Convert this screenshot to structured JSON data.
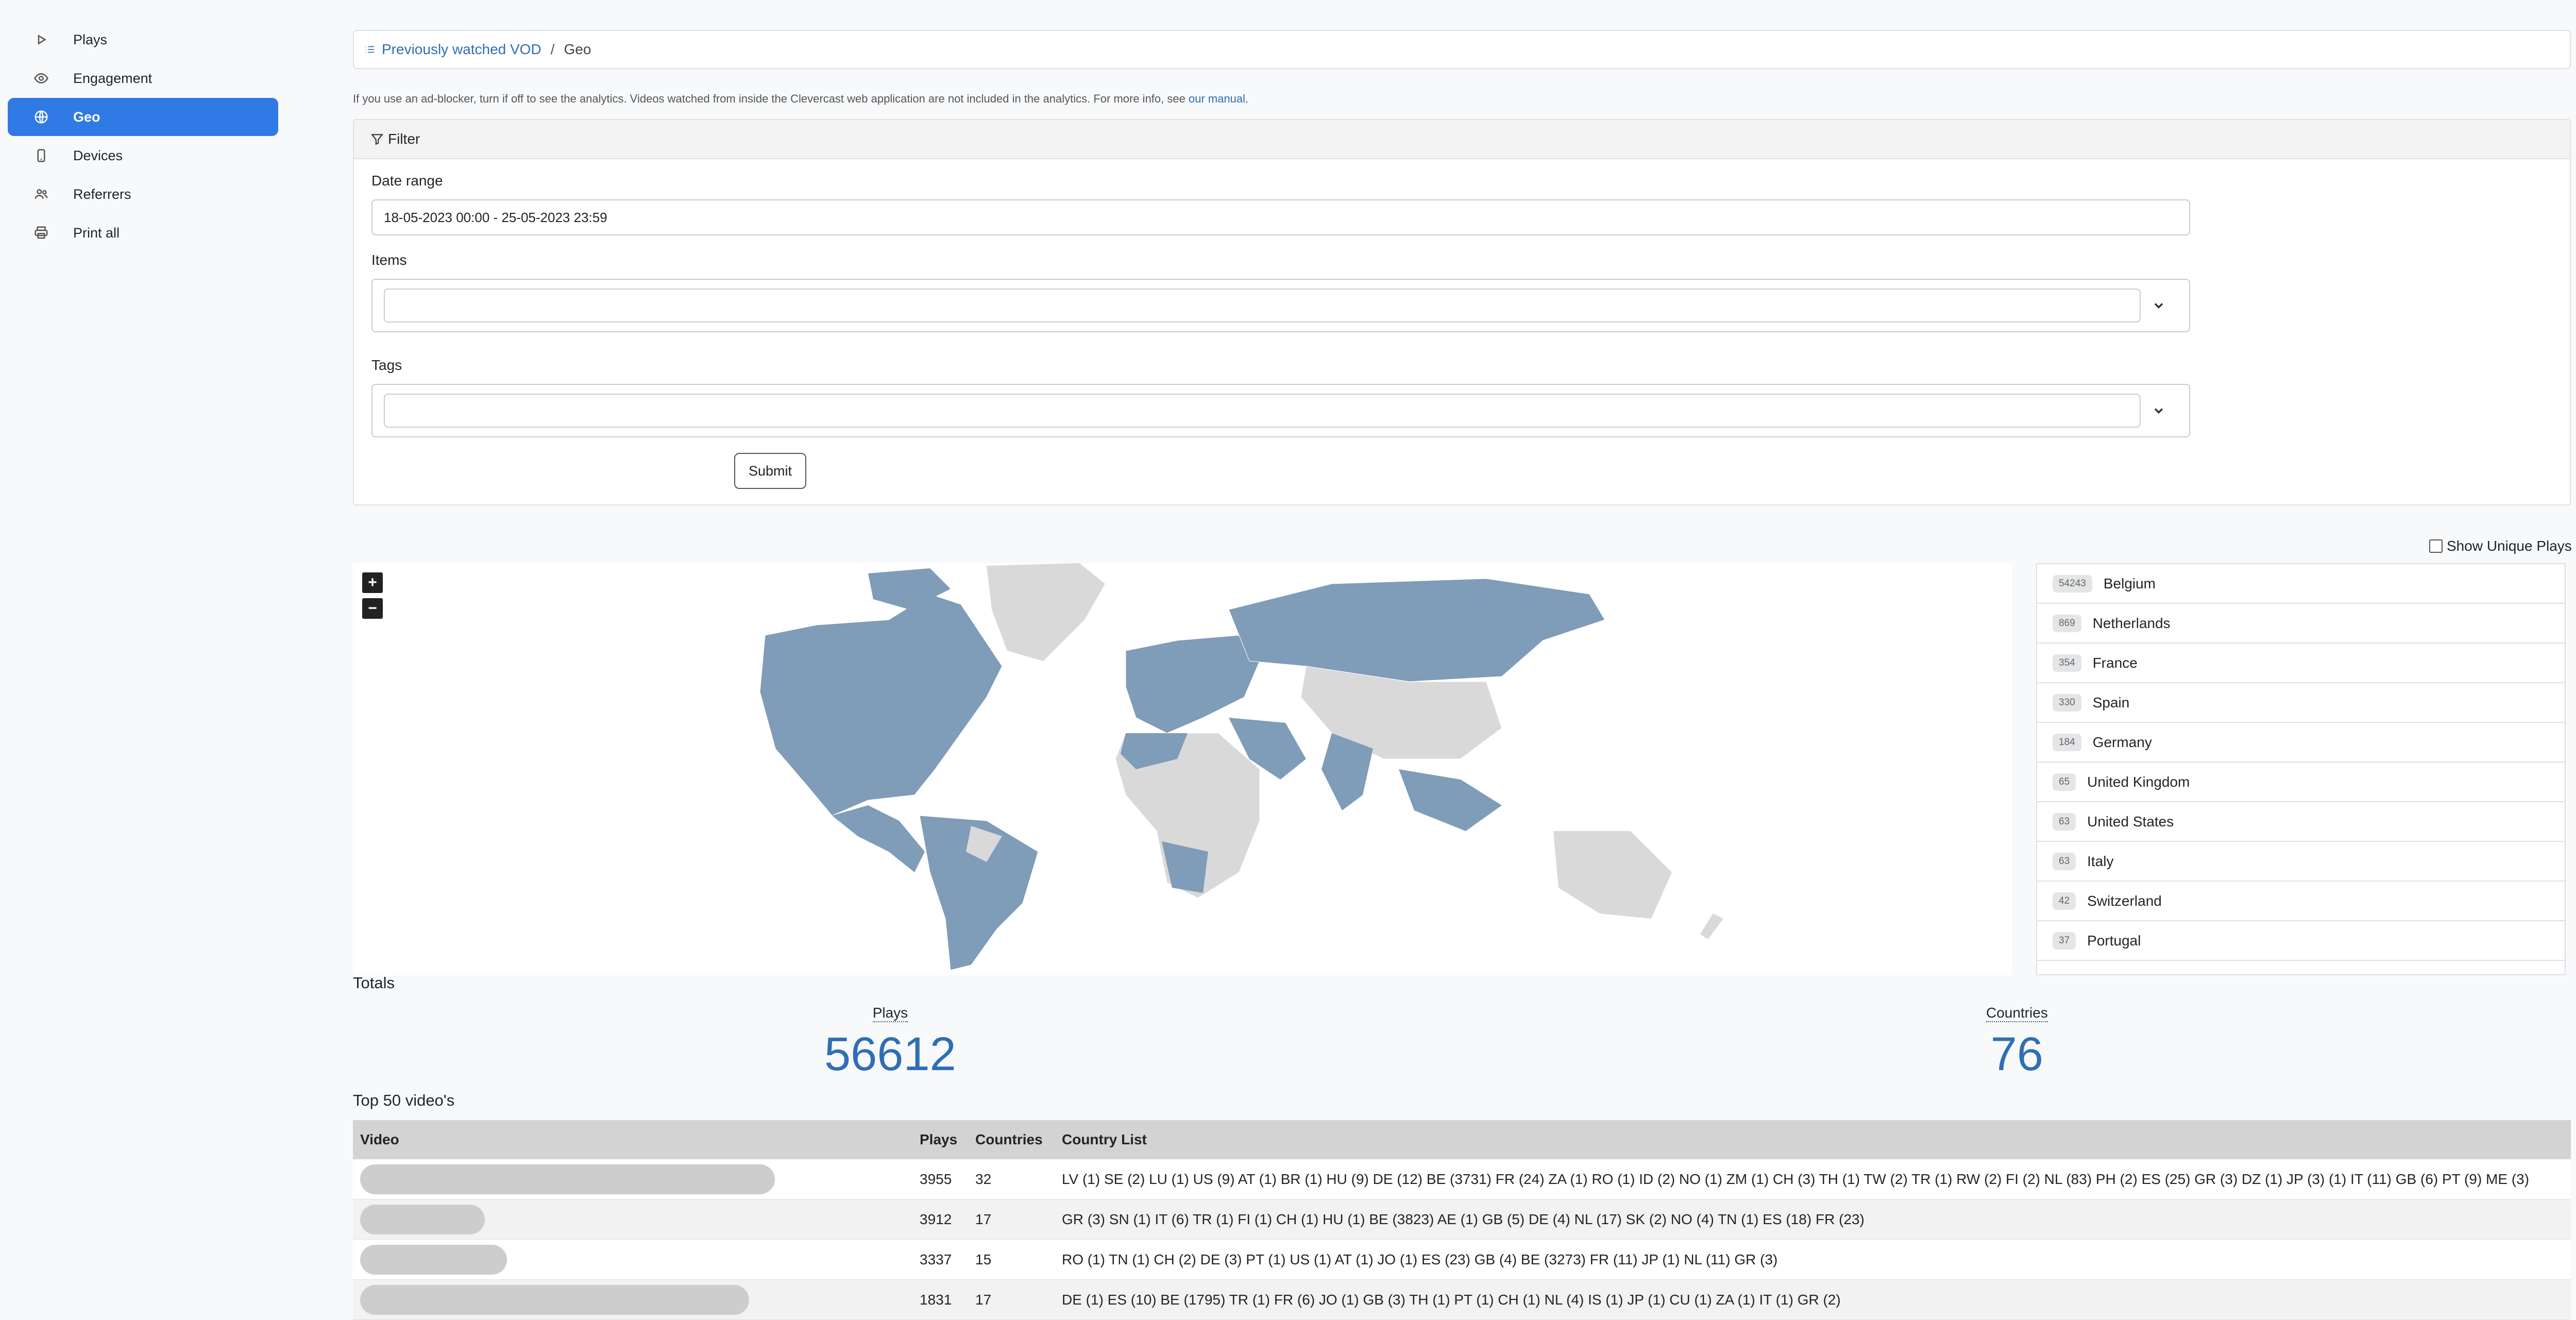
{
  "sidebar": {
    "items": [
      {
        "label": "Plays",
        "icon": "play-icon"
      },
      {
        "label": "Engagement",
        "icon": "eye-icon"
      },
      {
        "label": "Geo",
        "icon": "globe-icon",
        "active": true
      },
      {
        "label": "Devices",
        "icon": "phone-icon"
      },
      {
        "label": "Referrers",
        "icon": "users-icon"
      },
      {
        "label": "Print all",
        "icon": "printer-icon"
      }
    ]
  },
  "breadcrumb": {
    "parent": "Previously watched VOD",
    "separator": "/",
    "current": "Geo"
  },
  "info": {
    "text": "If you use an ad-blocker, turn if off to see the analytics. Videos watched from inside the Clevercast web application are not included in the analytics. For more info, see ",
    "link": "our manual",
    "suffix": "."
  },
  "filter": {
    "title": "Filter",
    "date_label": "Date range",
    "date_value": "18-05-2023 00:00 - 25-05-2023 23:59",
    "items_label": "Items",
    "tags_label": "Tags",
    "submit": "Submit"
  },
  "show_unique": "Show Unique Plays",
  "zoom": {
    "in": "+",
    "out": "−"
  },
  "countries": [
    {
      "count": "54243",
      "name": "Belgium"
    },
    {
      "count": "869",
      "name": "Netherlands"
    },
    {
      "count": "354",
      "name": "France"
    },
    {
      "count": "330",
      "name": "Spain"
    },
    {
      "count": "184",
      "name": "Germany"
    },
    {
      "count": "65",
      "name": "United Kingdom"
    },
    {
      "count": "63",
      "name": "United States"
    },
    {
      "count": "63",
      "name": "Italy"
    },
    {
      "count": "42",
      "name": "Switzerland"
    },
    {
      "count": "37",
      "name": "Portugal"
    }
  ],
  "totals": {
    "title": "Totals",
    "plays_label": "Plays",
    "plays_value": "56612",
    "countries_label": "Countries",
    "countries_value": "76"
  },
  "top50": {
    "title": "Top 50 video's",
    "headers": [
      "Video",
      "Plays",
      "Countries",
      "Country List"
    ],
    "rows": [
      {
        "plays": "3955",
        "countries": "32",
        "list": "LV (1) SE (2) LU (1) US (9) AT (1) BR (1) HU (9) DE (12) BE (3731) FR (24) ZA (1) RO (1) ID (2) NO (1) ZM (1) CH (3) TH (1) TW (2) TR (1) RW (2) FI (2) NL (83) PH (2) ES (25) GR (3) DZ (1) JP (3) (1) IT (11) GB (6) PT (9) ME (3)"
      },
      {
        "plays": "3912",
        "countries": "17",
        "list": "GR (3) SN (1) IT (6) TR (1) FI (1) CH (1) HU (1) BE (3823) AE (1) GB (5) DE (4) NL (17) SK (2) NO (4) TN (1) ES (18) FR (23)"
      },
      {
        "plays": "3337",
        "countries": "15",
        "list": "RO (1) TN (1) CH (2) DE (3) PT (1) US (1) AT (1) JO (1) ES (23) GB (4) BE (3273) FR (11) JP (1) NL (11) GR (3)"
      },
      {
        "plays": "1831",
        "countries": "17",
        "list": "DE (1) ES (10) BE (1795) TR (1) FR (6) JO (1) GB (3) TH (1) PT (1) CH (1) NL (4) IS (1) JP (1) CU (1) ZA (1) IT (1) GR (2)"
      }
    ]
  }
}
